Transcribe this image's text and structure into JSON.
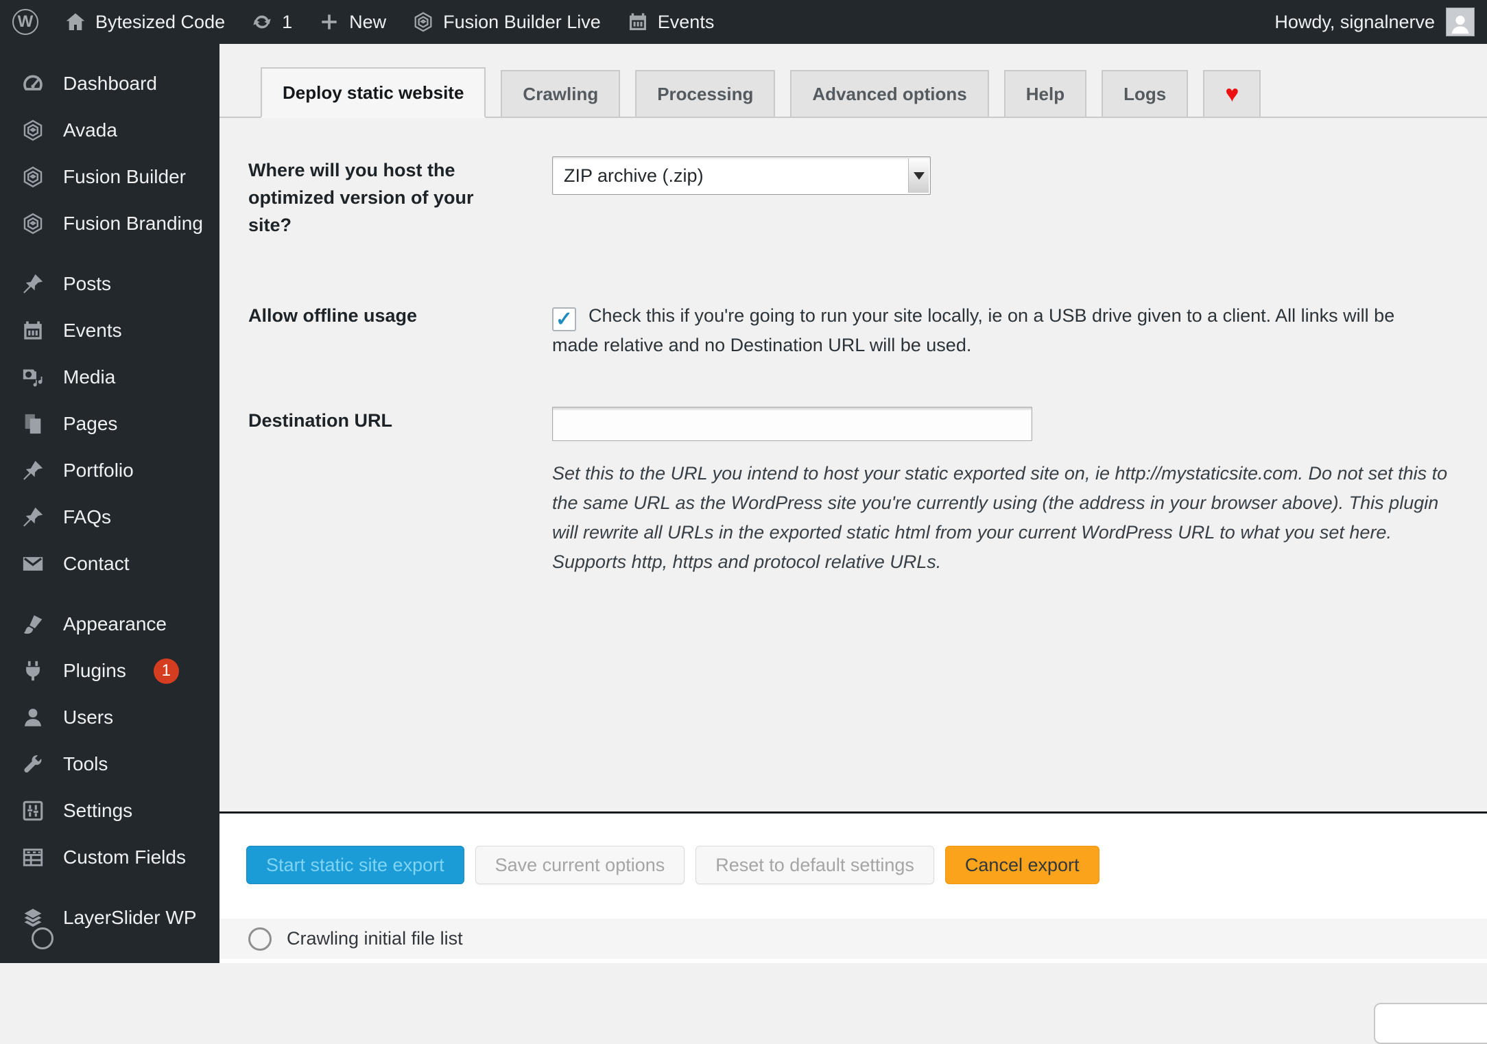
{
  "admin_bar": {
    "wp_logo_letter": "W",
    "site_name": "Bytesized Code",
    "updates_count": "1",
    "new_label": "New",
    "fusion_builder_live_label": "Fusion Builder Live",
    "events_label": "Events",
    "howdy": "Howdy, signalnerve"
  },
  "sidebar": {
    "items": [
      {
        "label": "Dashboard"
      },
      {
        "label": "Avada"
      },
      {
        "label": "Fusion Builder"
      },
      {
        "label": "Fusion Branding"
      },
      {
        "label": "Posts"
      },
      {
        "label": "Events"
      },
      {
        "label": "Media"
      },
      {
        "label": "Pages"
      },
      {
        "label": "Portfolio"
      },
      {
        "label": "FAQs"
      },
      {
        "label": "Contact"
      },
      {
        "label": "Appearance"
      },
      {
        "label": "Plugins",
        "badge": "1"
      },
      {
        "label": "Users"
      },
      {
        "label": "Tools"
      },
      {
        "label": "Settings"
      },
      {
        "label": "Custom Fields"
      },
      {
        "label": "LayerSlider WP"
      }
    ]
  },
  "tabs": [
    {
      "label": "Deploy static website",
      "active": true
    },
    {
      "label": "Crawling"
    },
    {
      "label": "Processing"
    },
    {
      "label": "Advanced options"
    },
    {
      "label": "Help"
    },
    {
      "label": "Logs"
    },
    {
      "label": "♥"
    }
  ],
  "form": {
    "host_question": {
      "label": "Where will you host the optimized version of your site?",
      "selected_option": "ZIP archive (.zip)"
    },
    "offline_usage": {
      "label": "Allow offline usage",
      "checked": true,
      "check_glyph": "✓",
      "description": "Check this if you're going to run your site locally, ie on a USB drive given to a client. All links will be made relative and no Destination URL will be used."
    },
    "destination_url": {
      "label": "Destination URL",
      "value": "",
      "help": "Set this to the URL you intend to host your static exported site on, ie http://mystaticsite.com. Do not set this to the same URL as the WordPress site you're currently using (the address in your browser above). This plugin will rewrite all URLs in the exported static html from your current WordPress URL to what you set here. Supports http, https and protocol relative URLs."
    }
  },
  "actions": {
    "start": "Start static site export",
    "save": "Save current options",
    "reset": "Reset to default settings",
    "cancel": "Cancel export"
  },
  "status": {
    "label": "Crawling initial file list"
  },
  "colors": {
    "admin_dark": "#23282d",
    "start_button": "#1c9cd6",
    "cancel_button": "#fba31b",
    "plugins_badge": "#d43d1f",
    "heart": "#ee1111",
    "checkbox_check": "#1e8cbe",
    "page_background": "#f1f1f1"
  }
}
